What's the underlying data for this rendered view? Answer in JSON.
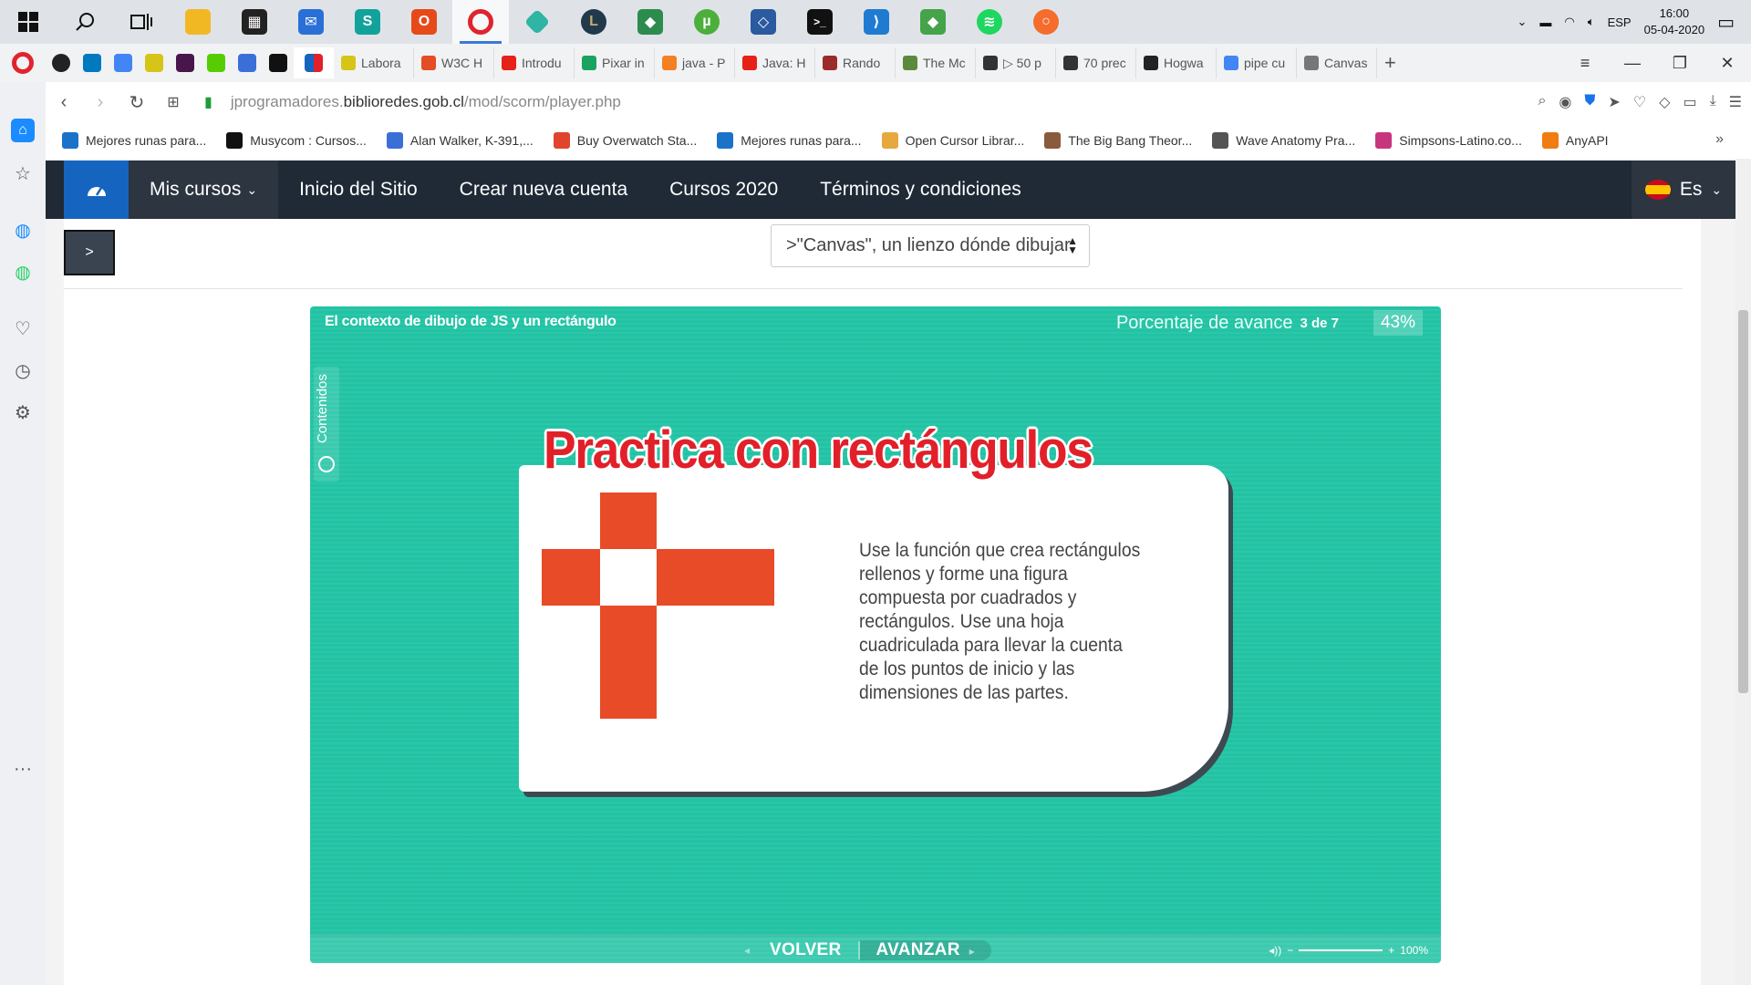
{
  "taskbar": {
    "apps": [
      "Windows start",
      "Search",
      "Task view",
      "File Explorer",
      "Microsoft Store",
      "Mail",
      "Sway",
      "Office",
      "Opera",
      "GitKraken",
      "League of Legends",
      "The Sims 4",
      "uTorrent",
      "Visual Studio",
      "Command Prompt",
      "Visual Studio Code",
      "Sims 4 Studio",
      "Spotify",
      "Origin"
    ],
    "tray": {
      "lang": "ESP",
      "time": "16:00",
      "date": "05-04-2020"
    }
  },
  "tabs": [
    {
      "label": "Labora",
      "color": "#d6c417"
    },
    {
      "label": "W3C H",
      "color": "#e44d26"
    },
    {
      "label": "Introdu",
      "color": "#e62117"
    },
    {
      "label": "Pixar in",
      "color": "#1aa260"
    },
    {
      "label": "java - P",
      "color": "#f48024"
    },
    {
      "label": "Java: H",
      "color": "#e62117"
    },
    {
      "label": "Rando",
      "color": "#9b2b2b"
    },
    {
      "label": "The Mc",
      "color": "#5b8a3c"
    },
    {
      "label": "▷ 50 p",
      "color": "#333333"
    },
    {
      "label": "70 prec",
      "color": "#333333"
    },
    {
      "label": "Hogwa",
      "color": "#222222"
    },
    {
      "label": "pipe cu",
      "color": "#4285f4"
    },
    {
      "label": "Canvas",
      "color": "#777777"
    }
  ],
  "address": {
    "domain_prefix": "jprogramadores.",
    "domain": "biblioredes.gob.cl",
    "path": "/mod/scorm/player.php"
  },
  "bookmarks": [
    {
      "label": "Mejores runas para...",
      "color": "#1a73c8"
    },
    {
      "label": "Musycom : Cursos...",
      "color": "#111111"
    },
    {
      "label": "Alan Walker, K-391,...",
      "color": "#3b6fd8"
    },
    {
      "label": "Buy Overwatch Sta...",
      "color": "#e0442d"
    },
    {
      "label": "Mejores runas para...",
      "color": "#1a73c8"
    },
    {
      "label": "Open Cursor Librar...",
      "color": "#e7a93d"
    },
    {
      "label": "The Big Bang Theor...",
      "color": "#8a5a3c"
    },
    {
      "label": "Wave Anatomy Pra...",
      "color": "#555555"
    },
    {
      "label": "Simpsons-Latino.co...",
      "color": "#c7367d"
    },
    {
      "label": "AnyAPI",
      "color": "#f07c12"
    }
  ],
  "sitenav": {
    "items": [
      "Mis cursos",
      "Inicio del Sitio",
      "Crear nueva cuenta",
      "Cursos 2020",
      "Términos y condiciones"
    ],
    "lang": "Es"
  },
  "page": {
    "toggle_label": ">",
    "sco_select": ">\"Canvas\", un lienzo dónde dibujar"
  },
  "player": {
    "lesson_title": "El contexto de dibujo de JS y un rectángulo",
    "progress_label": "Porcentaje de avance",
    "progress_count": "3 de 7",
    "progress_pct": "43%",
    "progress_value": 0.43,
    "contents_label": "Contenidos",
    "slide_heading": "Practica con rectángulos",
    "instructions": "Use la función que crea rectángulos rellenos y forme una figura compuesta por cuadrados y rectángulos. Use una hoja cuadriculada para llevar la cuenta de los puntos de inicio y las dimensiones de las partes.",
    "back_label": "VOLVER",
    "next_label": "AVANZAR",
    "volume_pct": "100%",
    "accent": "#22c3a4",
    "heading_color": "#e1202a",
    "cross_color": "#e84b27"
  }
}
